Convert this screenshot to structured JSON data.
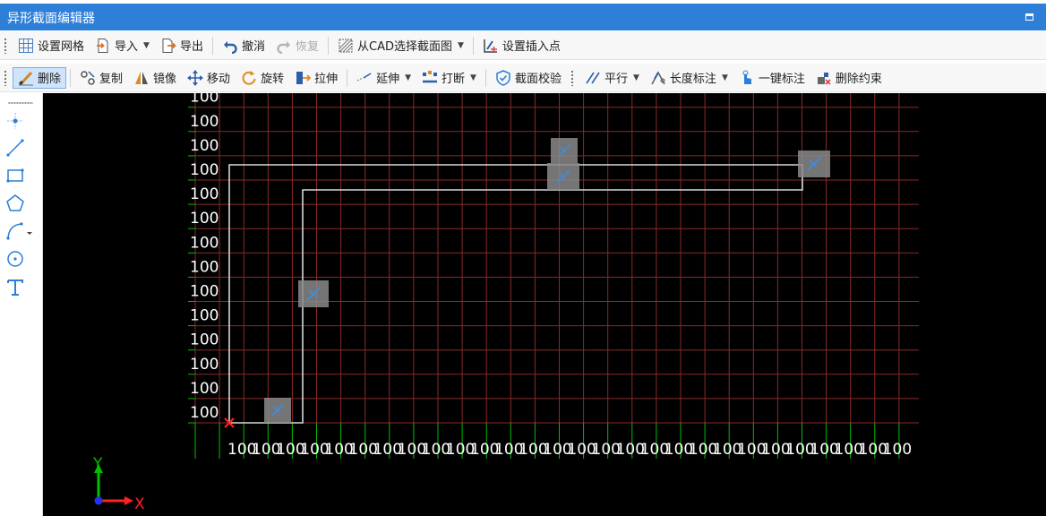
{
  "window": {
    "title": "异形截面编辑器"
  },
  "toolbar1": {
    "grid": "设置网格",
    "import": "导入",
    "export": "导出",
    "undo": "撤消",
    "redo": "恢复",
    "cad_select": "从CAD选择截面图",
    "insert_point": "设置插入点"
  },
  "toolbar2": {
    "delete": "删除",
    "copy": "复制",
    "mirror": "镜像",
    "move": "移动",
    "rotate": "旋转",
    "stretch": "拉伸",
    "extend": "延伸",
    "break": "打断",
    "check": "截面校验",
    "parallel": "平行",
    "length_dim": "长度标注",
    "auto_dim": "一键标注",
    "delete_constraint": "删除约束"
  },
  "canvas": {
    "grid_label": "100",
    "axis_y": "Y",
    "axis_x": "X",
    "colors": {
      "grid": "#8a2a2a",
      "tick": "#00c000",
      "shape": "#d8d8d8",
      "origin": "#ff2020"
    }
  }
}
